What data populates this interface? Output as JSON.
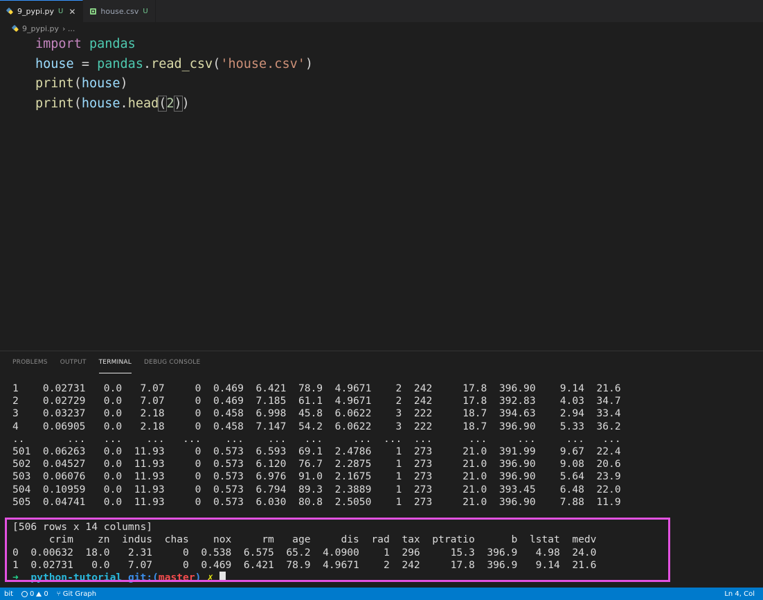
{
  "tabs": [
    {
      "label": "9_pypi.py",
      "status": "U",
      "active": true
    },
    {
      "label": "house.csv",
      "status": "U",
      "active": false
    }
  ],
  "breadcrumb": {
    "file": "9_pypi.py",
    "trail": "› ..."
  },
  "code": {
    "line1": {
      "kw": "import",
      "mod": "pandas"
    },
    "line2": {
      "var": "house",
      "eq": " = ",
      "mod": "pandas",
      "dot": ".",
      "fn": "read_csv",
      "open": "(",
      "str": "'house.csv'",
      "close": ")"
    },
    "line3": {
      "fn": "print",
      "open": "(",
      "var": "house",
      "close": ")"
    },
    "line4": {
      "fn": "print",
      "open": "(",
      "var": "house",
      "dot": ".",
      "fn2": "head",
      "open2": "(",
      "num": "2",
      "close2": ")",
      "close": ")"
    }
  },
  "panel_tabs": [
    "PROBLEMS",
    "OUTPUT",
    "TERMINAL",
    "DEBUG CONSOLE"
  ],
  "terminal": {
    "lines": [
      "1    0.02731   0.0   7.07     0  0.469  6.421  78.9  4.9671    2  242     17.8  396.90    9.14  21.6",
      "2    0.02729   0.0   7.07     0  0.469  7.185  61.1  4.9671    2  242     17.8  392.83    4.03  34.7",
      "3    0.03237   0.0   2.18     0  0.458  6.998  45.8  6.0622    3  222     18.7  394.63    2.94  33.4",
      "4    0.06905   0.0   2.18     0  0.458  7.147  54.2  6.0622    3  222     18.7  396.90    5.33  36.2",
      "..       ...   ...    ...   ...    ...    ...   ...     ...  ...  ...      ...     ...     ...   ...",
      "501  0.06263   0.0  11.93     0  0.573  6.593  69.1  2.4786    1  273     21.0  391.99    9.67  22.4",
      "502  0.04527   0.0  11.93     0  0.573  6.120  76.7  2.2875    1  273     21.0  396.90    9.08  20.6",
      "503  0.06076   0.0  11.93     0  0.573  6.976  91.0  2.1675    1  273     21.0  396.90    5.64  23.9",
      "504  0.10959   0.0  11.93     0  0.573  6.794  89.3  2.3889    1  273     21.0  393.45    6.48  22.0",
      "505  0.04741   0.0  11.93     0  0.573  6.030  80.8  2.5050    1  273     21.0  396.90    7.88  11.9",
      "",
      "[506 rows x 14 columns]",
      "      crim    zn  indus  chas    nox     rm   age     dis  rad  tax  ptratio      b  lstat  medv",
      "0  0.00632  18.0   2.31     0  0.538  6.575  65.2  4.0900    1  296     15.3  396.9   4.98  24.0",
      "1  0.02731   0.0   7.07     0  0.469  6.421  78.9  4.9671    2  242     17.8  396.9   9.14  21.6"
    ],
    "prompt": {
      "arrow": "➜",
      "dir": "python-tutorial",
      "git": "git:(",
      "branch": "master",
      "git_close": ")",
      "dirty": "✗"
    }
  },
  "statusbar": {
    "left_label": "bit",
    "errors": "0",
    "warnings": "0",
    "git_graph": "Git Graph",
    "position": "Ln 4, Col"
  }
}
